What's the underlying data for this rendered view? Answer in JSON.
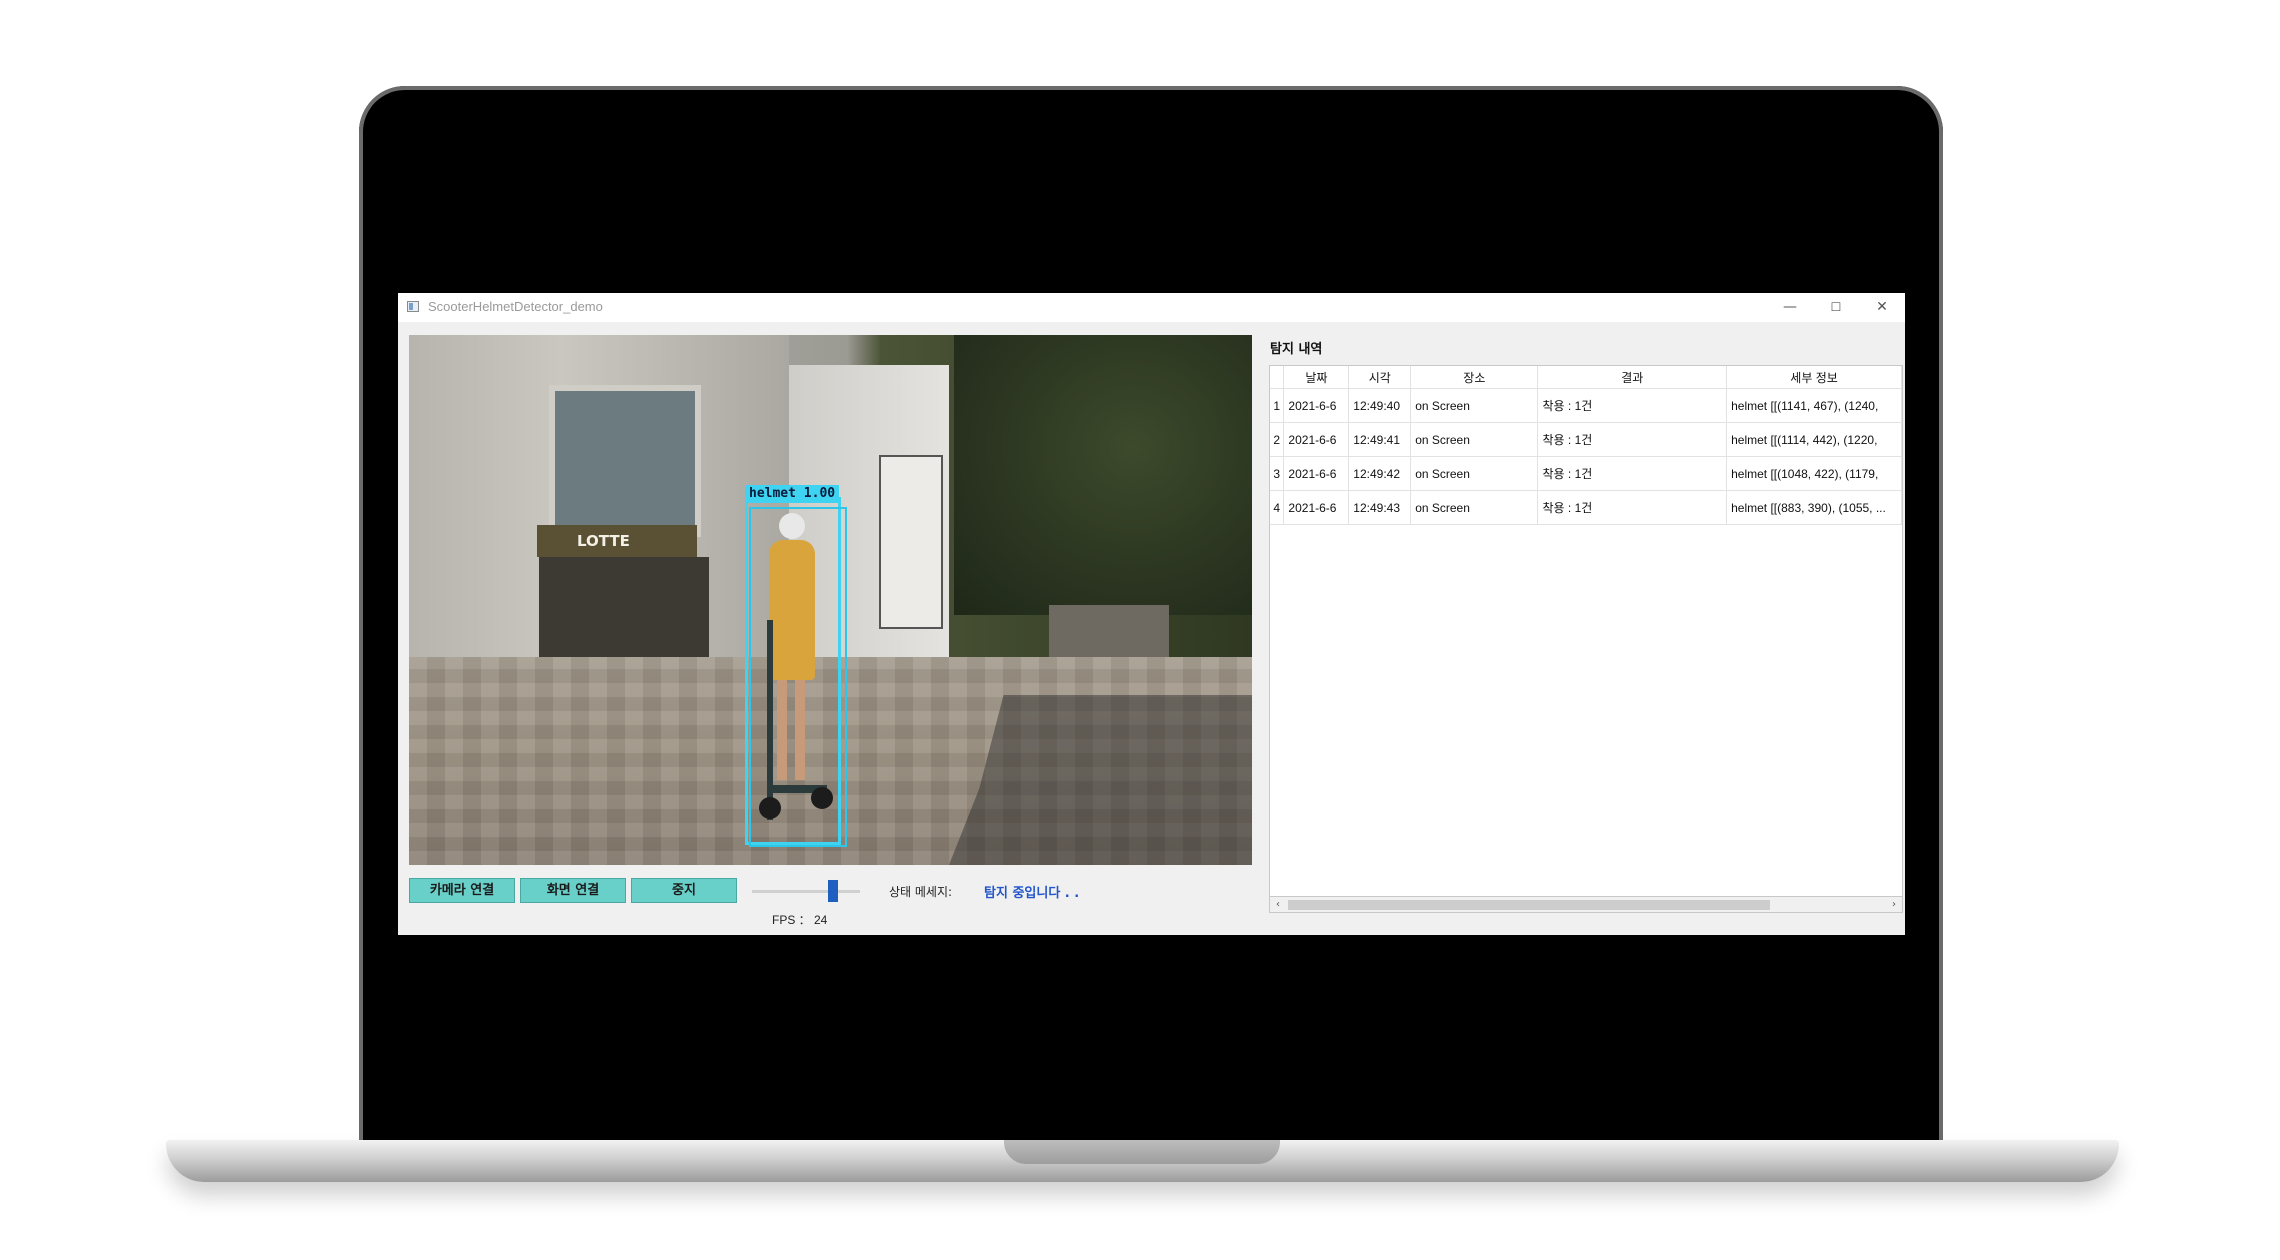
{
  "window": {
    "title": "ScooterHelmetDetector_demo",
    "minimize_glyph": "—",
    "maximize_glyph": "☐",
    "close_glyph": "✕"
  },
  "video": {
    "detection_label": "helmet 1.00",
    "store_sign": "LOTTE"
  },
  "controls": {
    "camera_button": "카메라 연결",
    "screen_button": "화면 연결",
    "stop_button": "중지",
    "fps_label": "FPS ： 24",
    "status_label": "상태 메세지:",
    "status_message": "탐지 중입니다 . ."
  },
  "history": {
    "title": "탐지 내역",
    "columns": [
      "날짜",
      "시각",
      "장소",
      "결과",
      "세부 정보"
    ],
    "rows": [
      {
        "index": "1",
        "date": "2021-6-6",
        "time": "12:49:40",
        "place": "on Screen",
        "result": "착용 : 1건",
        "detail": "helmet [[(1141, 467), (1240,"
      },
      {
        "index": "2",
        "date": "2021-6-6",
        "time": "12:49:41",
        "place": "on Screen",
        "result": "착용 : 1건",
        "detail": "helmet [[(1114, 442), (1220,"
      },
      {
        "index": "3",
        "date": "2021-6-6",
        "time": "12:49:42",
        "place": "on Screen",
        "result": "착용 : 1건",
        "detail": "helmet [[(1048, 422), (1179,"
      },
      {
        "index": "4",
        "date": "2021-6-6",
        "time": "12:49:43",
        "place": "on Screen",
        "result": "착용 : 1건",
        "detail": "helmet [[(883, 390), (1055, ..."
      }
    ],
    "scroll_left_glyph": "‹",
    "scroll_right_glyph": "›"
  },
  "colors": {
    "button_bg": "#69cfc9",
    "status_text": "#2155c9",
    "detection_box": "#3fd3f2",
    "slider_handle": "#1f5fbf"
  }
}
